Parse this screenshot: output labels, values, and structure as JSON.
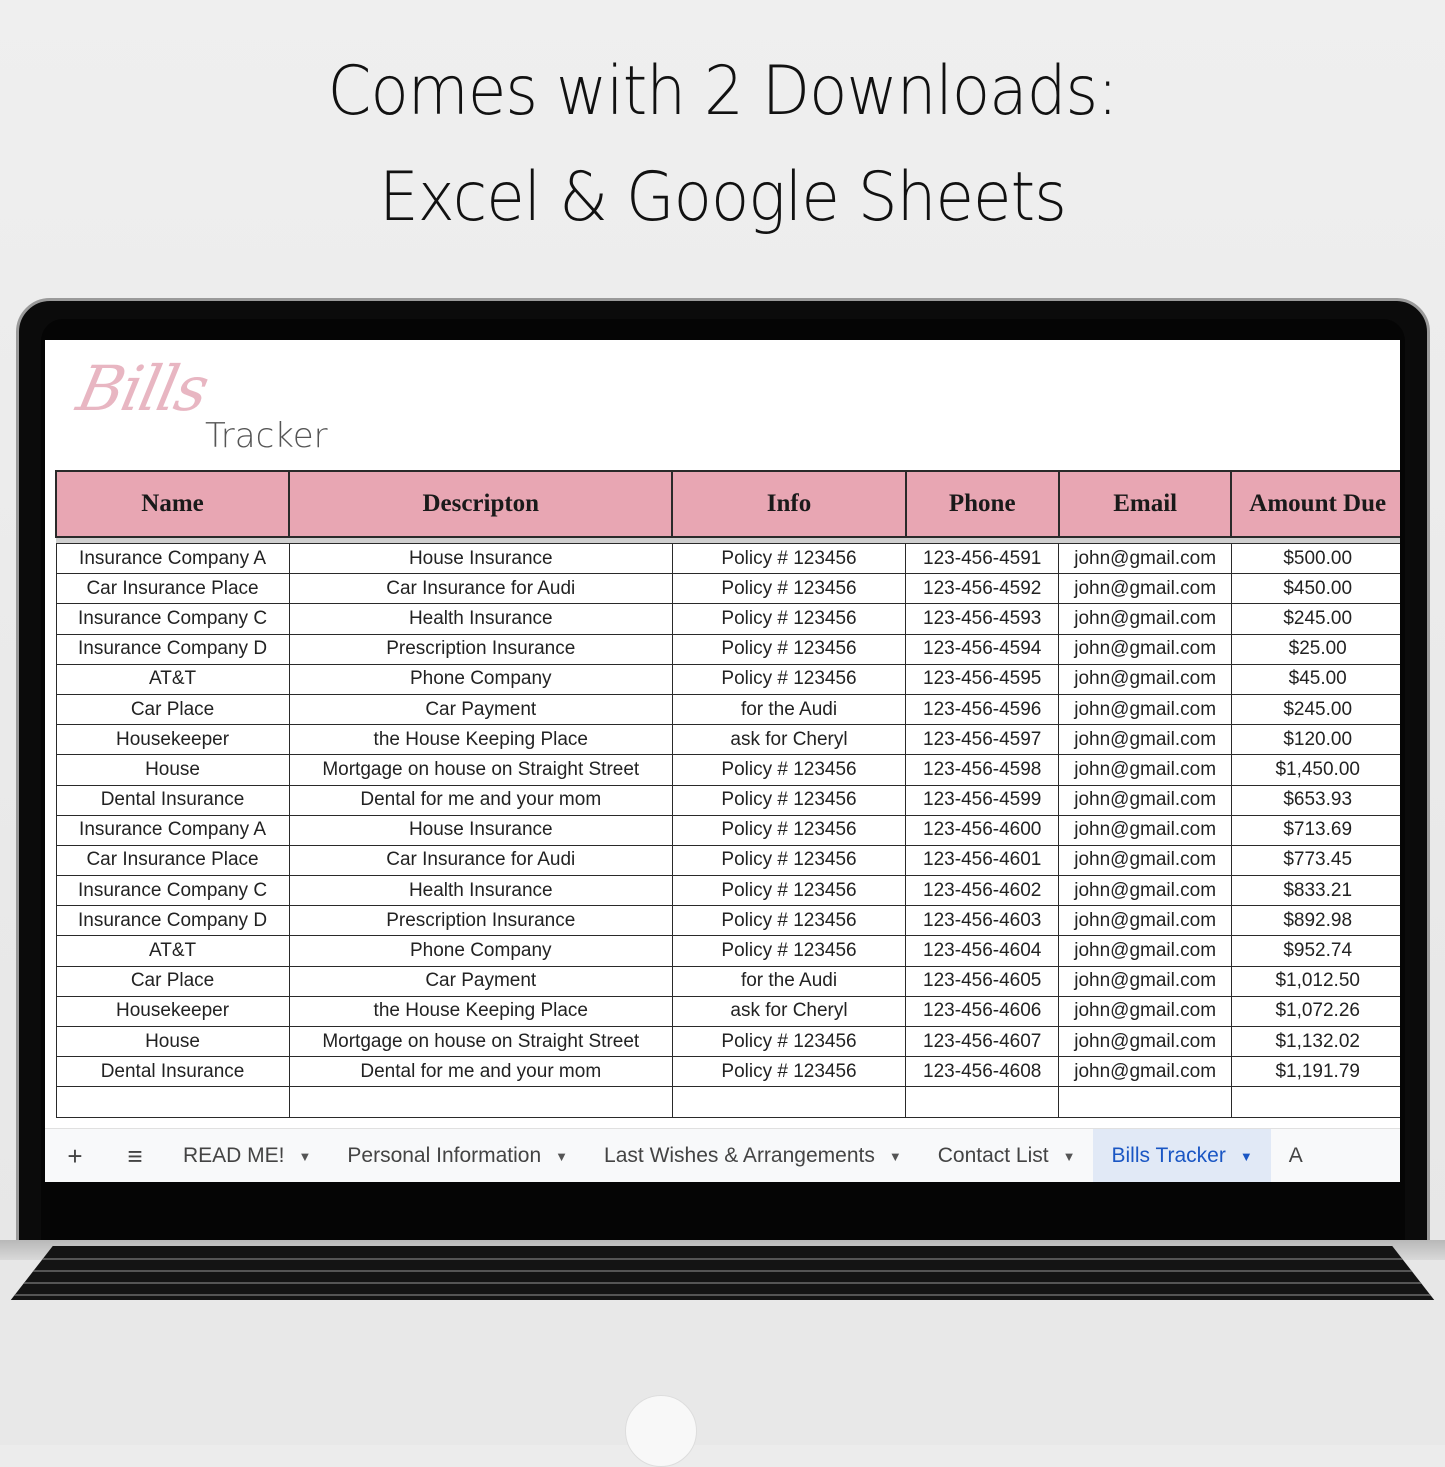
{
  "headline": {
    "line1": "Comes with 2 Downloads:",
    "line2": "Excel & Google Sheets"
  },
  "sheet": {
    "logo_script": "Bills",
    "logo_text": "Tracker",
    "header_color": "#e8a6b3",
    "columns": [
      "Name",
      "Descripton",
      "Info",
      "Phone",
      "Email",
      "Amount Due"
    ],
    "rows": [
      [
        "Insurance Company A",
        "House Insurance",
        "Policy # 123456",
        "123-456-4591",
        "john@gmail.com",
        "$500.00"
      ],
      [
        "Car Insurance Place",
        "Car Insurance for Audi",
        "Policy # 123456",
        "123-456-4592",
        "john@gmail.com",
        "$450.00"
      ],
      [
        "Insurance Company C",
        "Health Insurance",
        "Policy # 123456",
        "123-456-4593",
        "john@gmail.com",
        "$245.00"
      ],
      [
        "Insurance Company D",
        "Prescription Insurance",
        "Policy # 123456",
        "123-456-4594",
        "john@gmail.com",
        "$25.00"
      ],
      [
        "AT&T",
        "Phone Company",
        "Policy # 123456",
        "123-456-4595",
        "john@gmail.com",
        "$45.00"
      ],
      [
        "Car Place",
        "Car Payment",
        "for the Audi",
        "123-456-4596",
        "john@gmail.com",
        "$245.00"
      ],
      [
        "Housekeeper",
        "the House Keeping Place",
        "ask for Cheryl",
        "123-456-4597",
        "john@gmail.com",
        "$120.00"
      ],
      [
        "House",
        "Mortgage on house on Straight Street",
        "Policy # 123456",
        "123-456-4598",
        "john@gmail.com",
        "$1,450.00"
      ],
      [
        "Dental Insurance",
        "Dental for me and your mom",
        "Policy # 123456",
        "123-456-4599",
        "john@gmail.com",
        "$653.93"
      ],
      [
        "Insurance Company A",
        "House Insurance",
        "Policy # 123456",
        "123-456-4600",
        "john@gmail.com",
        "$713.69"
      ],
      [
        "Car Insurance Place",
        "Car Insurance for Audi",
        "Policy # 123456",
        "123-456-4601",
        "john@gmail.com",
        "$773.45"
      ],
      [
        "Insurance Company C",
        "Health Insurance",
        "Policy # 123456",
        "123-456-4602",
        "john@gmail.com",
        "$833.21"
      ],
      [
        "Insurance Company D",
        "Prescription Insurance",
        "Policy # 123456",
        "123-456-4603",
        "john@gmail.com",
        "$892.98"
      ],
      [
        "AT&T",
        "Phone Company",
        "Policy # 123456",
        "123-456-4604",
        "john@gmail.com",
        "$952.74"
      ],
      [
        "Car Place",
        "Car Payment",
        "for the Audi",
        "123-456-4605",
        "john@gmail.com",
        "$1,012.50"
      ],
      [
        "Housekeeper",
        "the House Keeping Place",
        "ask for Cheryl",
        "123-456-4606",
        "john@gmail.com",
        "$1,072.26"
      ],
      [
        "House",
        "Mortgage on house on Straight Street",
        "Policy # 123456",
        "123-456-4607",
        "john@gmail.com",
        "$1,132.02"
      ],
      [
        "Dental Insurance",
        "Dental for me and your mom",
        "Policy # 123456",
        "123-456-4608",
        "john@gmail.com",
        "$1,191.79"
      ]
    ]
  },
  "tabbar": {
    "add_icon": "+",
    "menu_icon": "≡",
    "caret": "▼",
    "tabs": [
      {
        "label": "READ ME!",
        "active": false
      },
      {
        "label": "Personal Information",
        "active": false
      },
      {
        "label": "Last Wishes & Arrangements",
        "active": false
      },
      {
        "label": "Contact List",
        "active": false
      },
      {
        "label": "Bills Tracker",
        "active": true
      },
      {
        "label": "A",
        "active": false
      }
    ],
    "active_color": "#1a56c4"
  }
}
